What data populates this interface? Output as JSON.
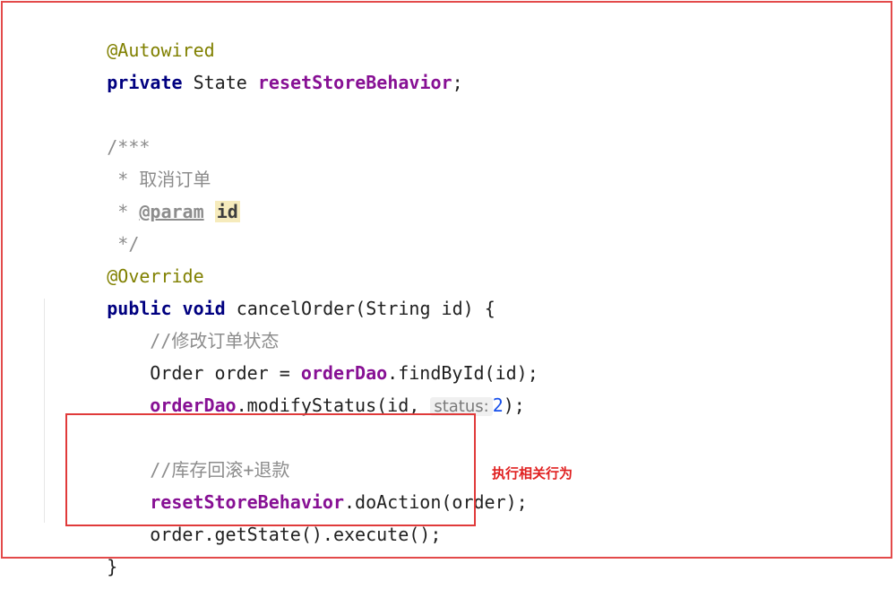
{
  "code": {
    "autowired_annotation": "@Autowired",
    "private_keyword": "private",
    "state_type": "State",
    "reset_field": "resetStoreBehavior",
    "semicolon": ";",
    "doc_open": "/***",
    "doc_star": " *",
    "doc_title": "取消订单",
    "doc_param_tag": "@param",
    "doc_param_name": "id",
    "doc_close": " */",
    "override_annotation": "@Override",
    "public_keyword": "public",
    "void_keyword": "void",
    "method_signature": "cancelOrder(String id) {",
    "comment_modify_status": "//修改订单状态",
    "order_decl": "Order order = ",
    "order_dao": "orderDao",
    "find_by_id": ".findById(id);",
    "modify_status_call": ".modifyStatus(id, ",
    "status_hint": "status:",
    "status_value": "2",
    "close_call": ");",
    "comment_rollback": "//库存回滚+退款",
    "do_action_call": ".doAction(order);",
    "execute_line": "order.getState().execute();",
    "closing_brace": "}"
  },
  "annotation_note": "执行相关行为",
  "colors": {
    "frame_border": "#e34a4a",
    "annotation": "#808000",
    "keyword": "#000080",
    "field": "#871094",
    "comment": "#8c8c8c",
    "number": "#1750eb",
    "note_text": "#e02020"
  }
}
